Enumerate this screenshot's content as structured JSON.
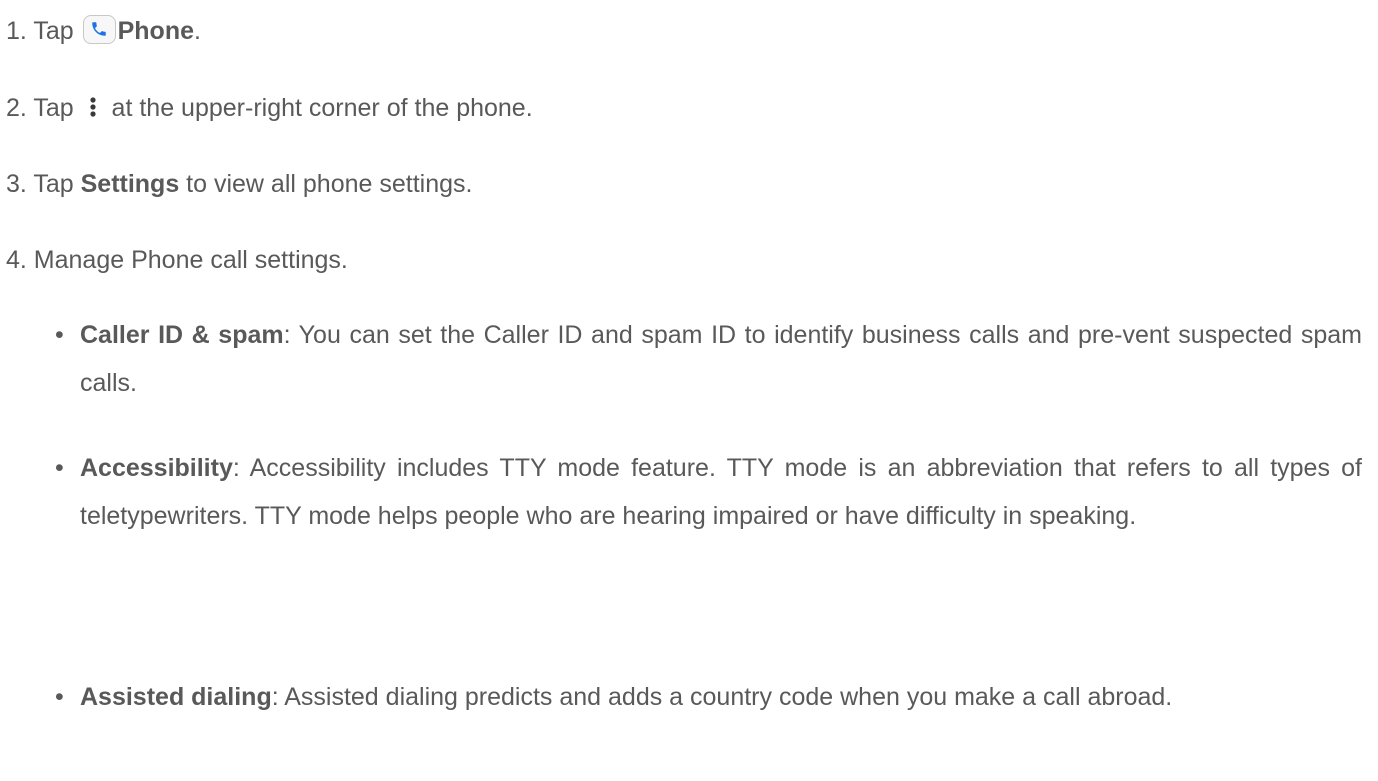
{
  "steps": [
    {
      "prefix": "1. Tap ",
      "bold": "Phone",
      "suffix": "."
    },
    {
      "prefix": "2. Tap ",
      "suffix": " at the upper-right corner of the phone."
    },
    {
      "prefix": "3. Tap ",
      "bold": "Settings",
      "suffix": " to view all phone settings."
    },
    {
      "text": "4. Manage Phone call settings."
    }
  ],
  "bullets": [
    {
      "marker": "•",
      "bold": "Caller ID & spam",
      "text": ": You can set the Caller ID and spam ID to identify business calls and pre-vent suspected spam calls."
    },
    {
      "marker": "•",
      "bold": "Accessibility",
      "text": ": Accessibility includes TTY mode feature. TTY mode is an abbreviation that refers to all types of teletypewriters. TTY mode helps people who are hearing impaired or have difficulty in speaking."
    },
    {
      "marker": "•",
      "bold": "Assisted dialing",
      "text": ": Assisted dialing predicts and adds a country code when you make a call abroad."
    }
  ],
  "icons": {
    "phone_app": "phone-app-icon",
    "more": "more-vertical-icon"
  },
  "colors": {
    "text": "#595959",
    "phone_icon_blue": "#1a73e8"
  }
}
